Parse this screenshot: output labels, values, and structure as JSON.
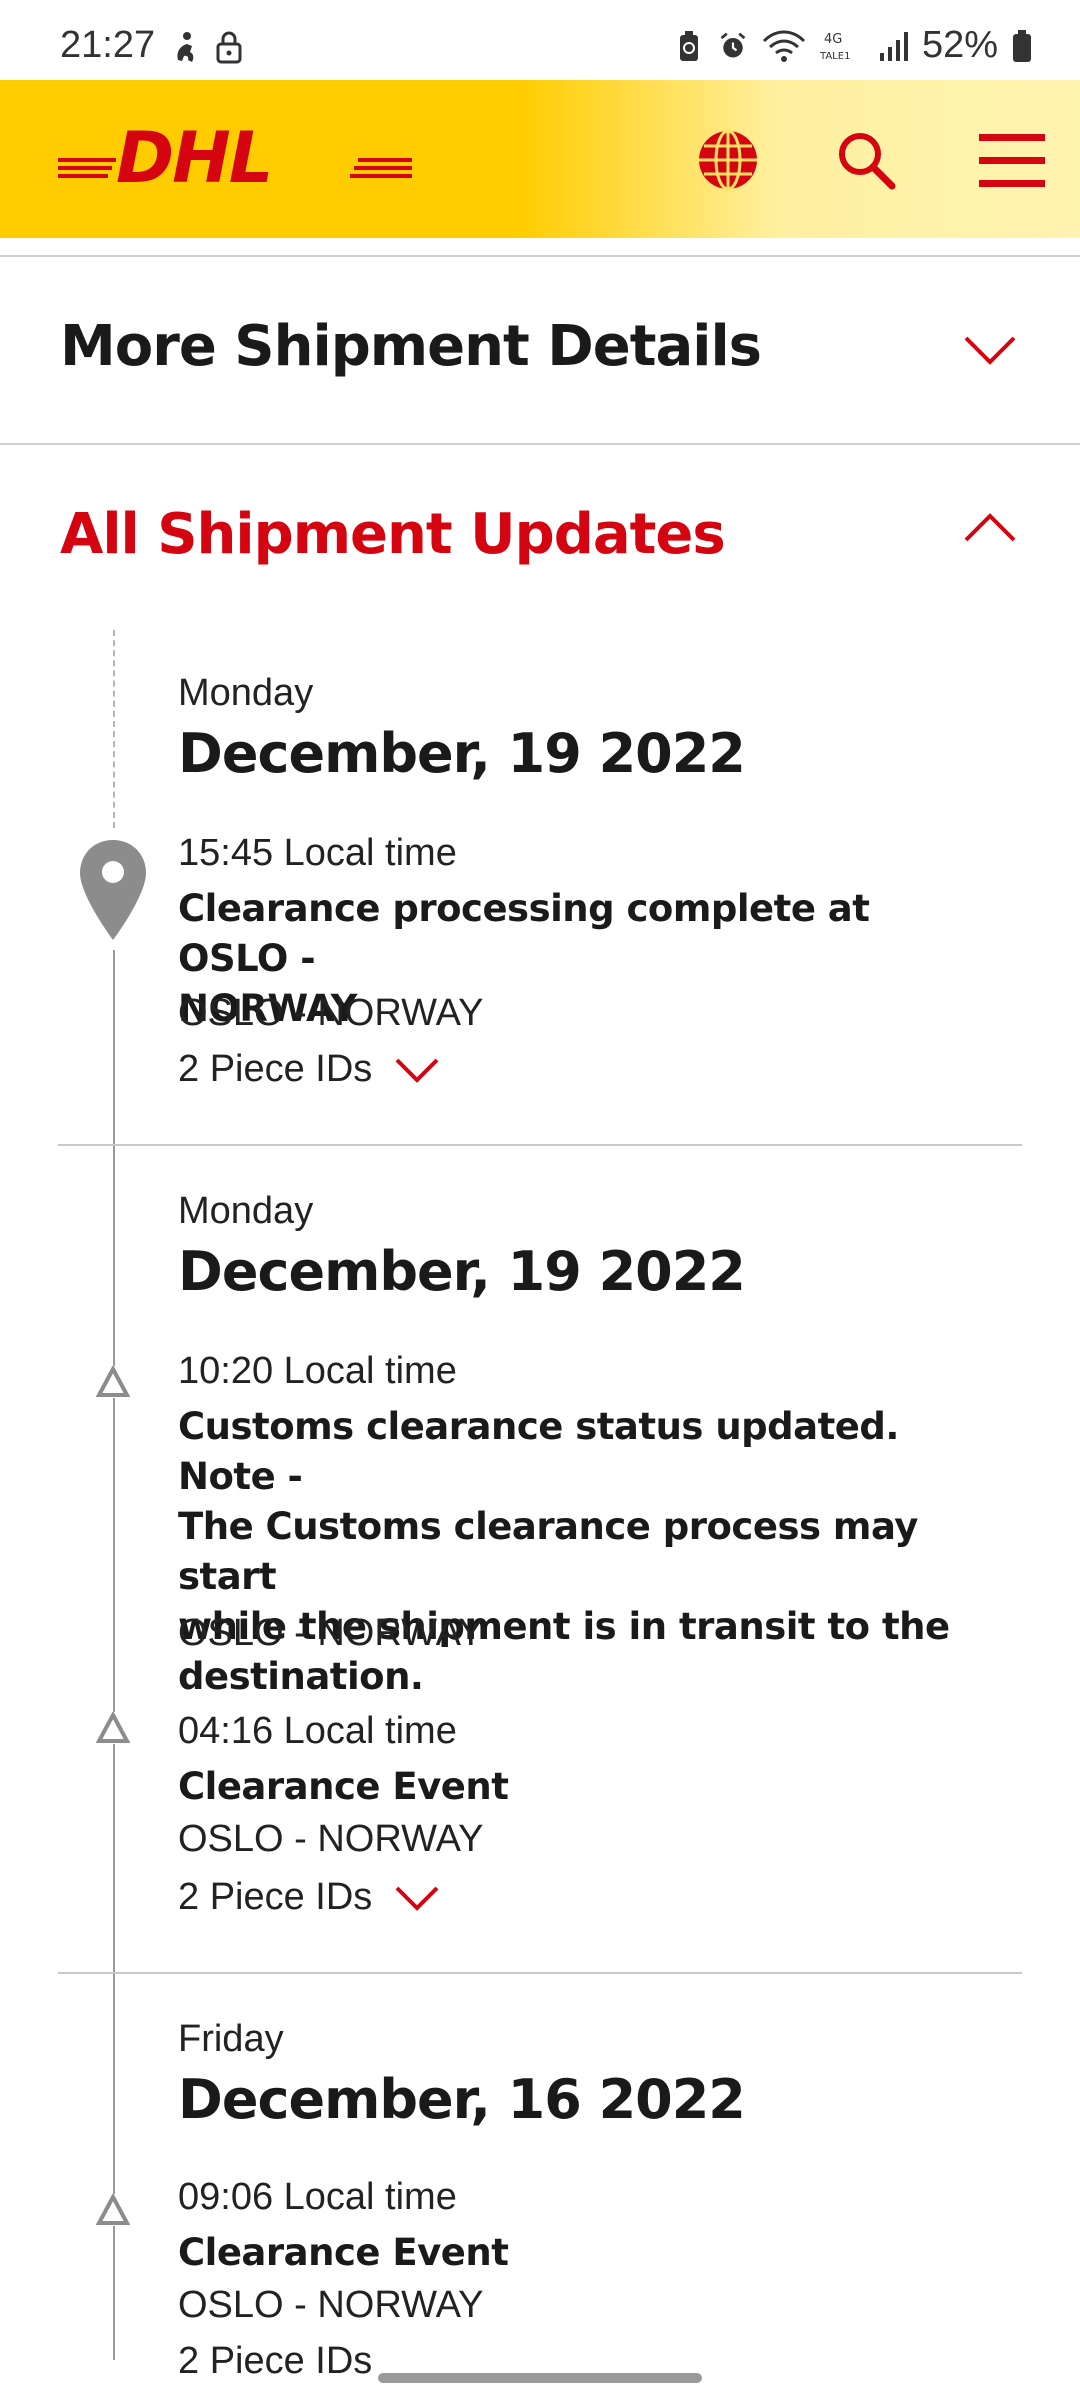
{
  "status_bar": {
    "time": "21:27",
    "battery": "52%",
    "network": "4G"
  },
  "header": {
    "brand": "DHL",
    "brand_color": "#d40511",
    "bg_color": "#ffcc00"
  },
  "sections": {
    "more_details": {
      "title": "More Shipment Details",
      "expanded": false
    },
    "all_updates": {
      "title": "All Shipment Updates",
      "expanded": true
    }
  },
  "groups": [
    {
      "day": "Monday",
      "date": "December, 19 2022",
      "events": [
        {
          "time": "15:45 Local time",
          "desc_lines": [
            "Clearance processing complete at OSLO -",
            "NORWAY"
          ],
          "location": "OSLO - NORWAY",
          "piece_ids": "2 Piece IDs"
        }
      ]
    },
    {
      "day": "Monday",
      "date": "December, 19 2022",
      "events": [
        {
          "time": "10:20 Local time",
          "desc_lines": [
            "Customs clearance status updated. Note -",
            "The Customs clearance process may start",
            "while the shipment is in transit to the",
            "destination."
          ],
          "location": "OSLO - NORWAY"
        },
        {
          "time": "04:16 Local time",
          "desc_lines": [
            "Clearance Event"
          ],
          "location": "OSLO - NORWAY",
          "piece_ids": "2 Piece IDs"
        }
      ]
    },
    {
      "day": "Friday",
      "date": "December, 16 2022",
      "events": [
        {
          "time": "09:06 Local time",
          "desc_lines": [
            "Clearance Event"
          ],
          "location": "OSLO - NORWAY",
          "piece_ids": "2 Piece IDs"
        }
      ]
    }
  ]
}
